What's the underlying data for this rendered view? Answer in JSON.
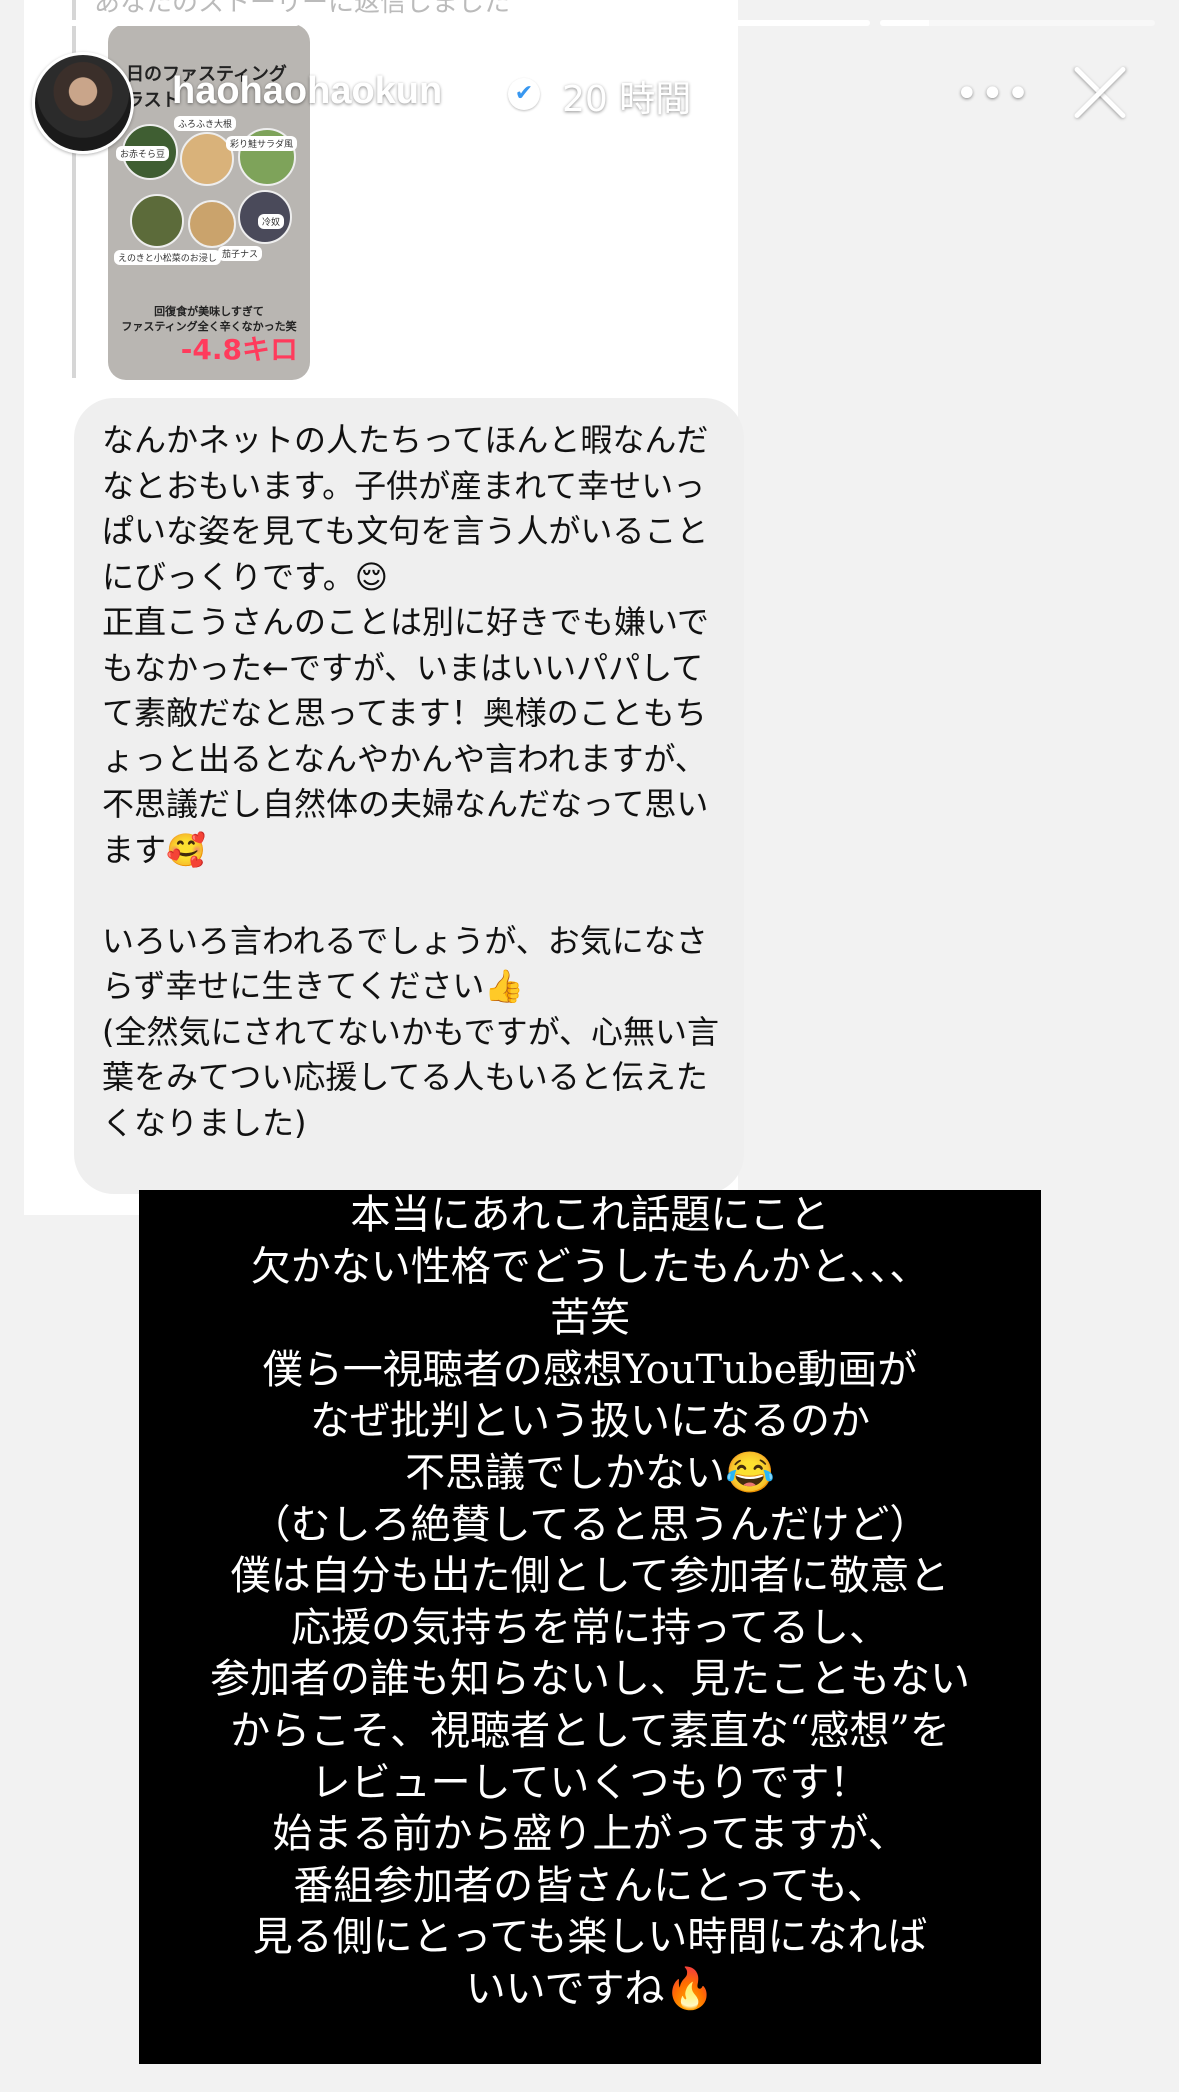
{
  "story": {
    "progress": [
      {
        "fill": 1.0
      },
      {
        "fill": 1.0
      },
      {
        "fill": 1.0
      },
      {
        "fill": 0.18
      }
    ]
  },
  "header": {
    "username": "haohaohaokun",
    "verified_icon": "✔",
    "time_ago": "20 時間",
    "more_label": "•••"
  },
  "dm": {
    "top_cut_text": "あなたのストーリーに返信しました",
    "shared_post": {
      "title": "日のファスティング\nラスト",
      "labels": [
        "ふろふき大根",
        "お赤そら豆",
        "彩り鮭サラダ風",
        "冷奴",
        "えのきと小松菜のお浸し",
        "茄子ナス"
      ],
      "caption": "回復食が美味しすぎて\nファスティング全く辛くなかった笑",
      "result": "-4.8キロ"
    },
    "message": "なんかネットの人たちってほんと暇なんだなとおもいます。子供が産まれて幸せいっぱいな姿を見ても文句を言う人がいることにびっくりです。😌\n正直こうさんのことは別に好きでも嫌いでもなかった←ですが、いまはいいパパしてて素敵だなと思ってます！奥様のこともちょっと出るとなんやかんや言われますが、不思議だし自然体の夫婦なんだなって思います🥰\n\nいろいろ言われるでしょうが、お気になさらず幸せに生きてください👍\n(全然気にされてないかもですが、心無い言葉をみてつい応援してる人もいると伝えたくなりました)"
  },
  "overlay": {
    "text": "本当にあれこれ話題にこと\n欠かない性格でどうしたもんかと、、、\n苦笑\n僕ら一視聴者の感想YouTube動画が\nなぜ批判という扱いになるのか\n不思議でしかない😂\n（むしろ絶賛してると思うんだけど）\n僕は自分も出た側として参加者に敬意と\n応援の気持ちを常に持ってるし、\n参加者の誰も知らないし、見たこともない\nからこそ、視聴者として素直な“感想”を\nレビューしていくつもりです！\n始まる前から盛り上がってますが、\n番組参加者の皆さんにとっても、\n見る側にとっても楽しい時間になれば\nいいですね🔥"
  },
  "colors": {
    "verified": "#3897f0",
    "result_text": "#ff3b5c",
    "bubble_bg": "#efefef",
    "overlay_bg": "#000000"
  }
}
